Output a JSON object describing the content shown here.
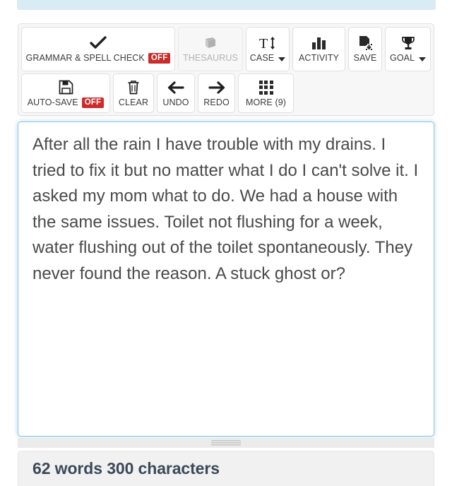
{
  "banner": {
    "name": "top-banner"
  },
  "toolbar": {
    "row1": [
      {
        "id": "grammar-spell-check",
        "label": "GRAMMAR & SPELL CHECK",
        "badge": "OFF",
        "icon": "check-icon",
        "disabled": false,
        "caret": false
      },
      {
        "id": "thesaurus",
        "label": "THESAURUS",
        "badge": "",
        "icon": "book-icon",
        "disabled": true,
        "caret": false
      },
      {
        "id": "case",
        "label": "CASE",
        "badge": "",
        "icon": "text-case-icon",
        "disabled": false,
        "caret": true
      },
      {
        "id": "activity",
        "label": "ACTIVITY",
        "badge": "",
        "icon": "bar-chart-icon",
        "disabled": false,
        "caret": false
      },
      {
        "id": "save",
        "label": "SAVE",
        "badge": "",
        "icon": "save-document-icon",
        "disabled": false,
        "caret": false
      },
      {
        "id": "goal",
        "label": "GOAL",
        "badge": "",
        "icon": "trophy-icon",
        "disabled": false,
        "caret": true
      }
    ],
    "row2": [
      {
        "id": "auto-save",
        "label": "AUTO-SAVE",
        "badge": "OFF",
        "icon": "floppy-disk-icon",
        "disabled": false,
        "caret": false
      },
      {
        "id": "clear",
        "label": "CLEAR",
        "badge": "",
        "icon": "trash-icon",
        "disabled": false,
        "caret": false
      },
      {
        "id": "undo",
        "label": "UNDO",
        "badge": "",
        "icon": "arrow-left-icon",
        "disabled": false,
        "caret": false
      },
      {
        "id": "redo",
        "label": "REDO",
        "badge": "",
        "icon": "arrow-right-icon",
        "disabled": false,
        "caret": false
      },
      {
        "id": "more",
        "label": "MORE (9)",
        "badge": "",
        "icon": "grid-icon",
        "disabled": false,
        "caret": false
      }
    ]
  },
  "editor": {
    "value": "After all the rain I have trouble with my drains. I tried to fix it but no matter what I do I can't solve it. I asked my mom what to do. We had a house with the same issues. Toilet not flushing for a week, water flushing out of the toilet spontaneously. They never found the reason. A stuck ghost or?",
    "placeholder": ""
  },
  "stats": {
    "text": "62 words 300 characters"
  },
  "colors": {
    "badge_red": "#cc2b2b",
    "editor_focus_border": "#8ec0e0",
    "banner_blue": "#d9ebf4",
    "stats_text": "#3c4858"
  }
}
